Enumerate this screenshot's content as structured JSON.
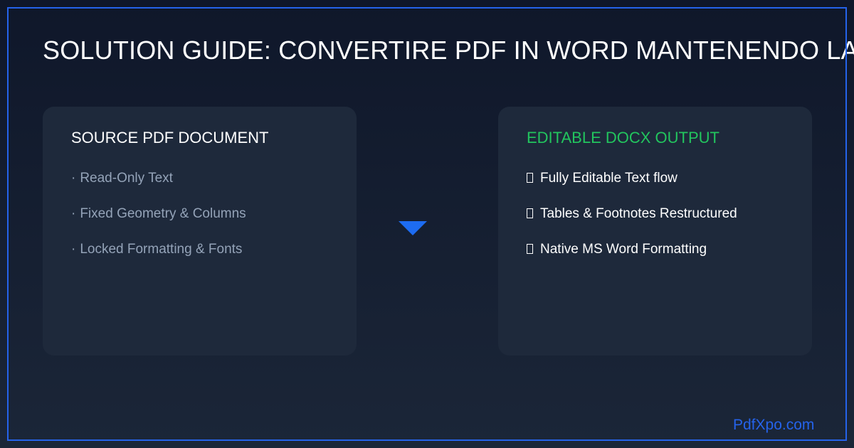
{
  "title": "SOLUTION GUIDE: CONVERTIRE PDF IN WORD MANTENENDO LA FORMATTAZIONE",
  "source_card": {
    "heading": "SOURCE PDF DOCUMENT",
    "bullet": "·",
    "items": [
      "Read-Only Text",
      "Fixed Geometry & Columns",
      "Locked Formatting & Fonts"
    ]
  },
  "output_card": {
    "heading": "EDITABLE DOCX OUTPUT",
    "items": [
      "Fully Editable Text flow",
      "Tables & Footnotes Restructured",
      "Native MS Word Formatting"
    ]
  },
  "arrow_icon": "arrow-down-icon",
  "brand": "PdfXpo.com",
  "colors": {
    "background": "#0f172a",
    "card": "#1e293b",
    "accent_blue": "#2563eb",
    "accent_green": "#22c55e",
    "muted_text": "#94a3b8"
  }
}
